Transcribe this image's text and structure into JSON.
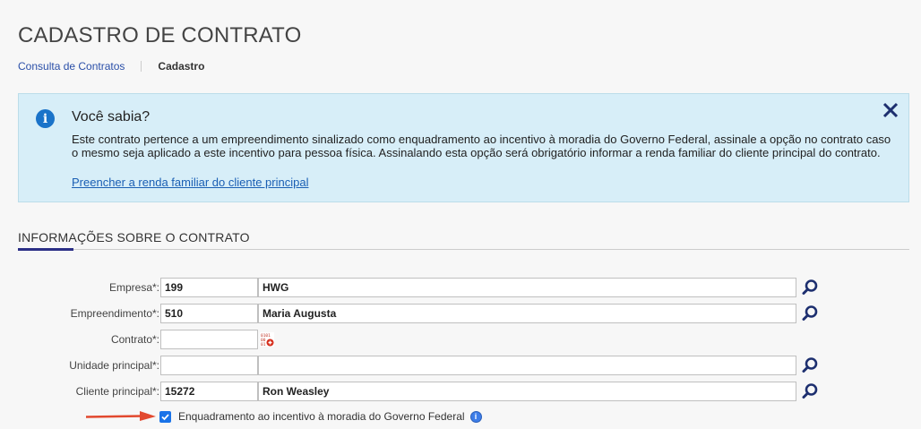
{
  "page": {
    "title": "CADASTRO DE CONTRATO"
  },
  "breadcrumb": {
    "link": "Consulta de Contratos",
    "current": "Cadastro"
  },
  "info": {
    "title": "Você sabia?",
    "text": "Este contrato pertence a um empreendimento sinalizado como enquadramento ao incentivo à moradia do Governo Federal, assinale a opção no contrato caso o mesmo seja aplicado a este incentivo para pessoa física. Assinalando esta opção será obrigatório informar a renda familiar do cliente principal do contrato.",
    "link": "Preencher a renda familiar do cliente principal",
    "close_symbol": "✕",
    "icon_symbol": "i"
  },
  "section": {
    "title": "INFORMAÇÕES SOBRE O CONTRATO"
  },
  "form": {
    "empresa": {
      "label": "Empresa*:",
      "code": "199",
      "name": "HWG"
    },
    "empreendimento": {
      "label": "Empreendimento*:",
      "code": "510",
      "name": "Maria Augusta"
    },
    "contrato": {
      "label": "Contrato*:",
      "code": ""
    },
    "unidade": {
      "label": "Unidade principal*:",
      "code": "",
      "name": ""
    },
    "cliente": {
      "label": "Cliente principal*:",
      "code": "15272",
      "name": "Ron Weasley"
    }
  },
  "checkbox": {
    "label": "Enquadramento ao incentivo à moradia do Governo Federal",
    "checked": true,
    "help_symbol": "i"
  },
  "colors": {
    "accent": "#2b2f86",
    "info_bg": "#d7eef8",
    "link": "#1a5fb4",
    "arrow": "#e2492f",
    "checkbox": "#1a73e8"
  },
  "icons": {
    "lookup": "magnifier-icon",
    "generate": "generate-number-icon",
    "info": "info-circle-icon",
    "close": "close-icon",
    "help": "help-info-icon"
  }
}
